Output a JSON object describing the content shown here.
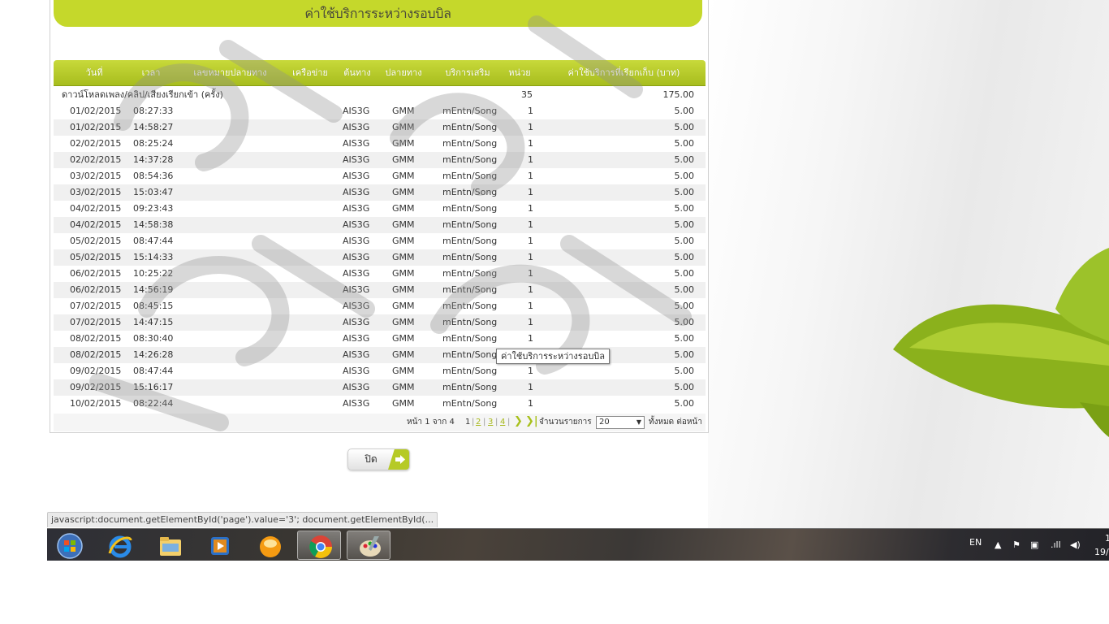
{
  "panel": {
    "title": "ค่าใช้บริการระหว่างรอบบิล",
    "columns": [
      "วันที่",
      "เวลา",
      "เลขหมายปลายทาง",
      "เครือข่าย",
      "ต้นทาง",
      "ปลายทาง",
      "บริการเสริม",
      "หน่วย",
      "ค่าใช้บริการที่เรียกเก็บ (บาท)"
    ],
    "group": {
      "label": "ดาวน์โหลดเพลง/คลิป/เสียงเรียกเข้า (ครั้ง)",
      "units": "35",
      "amount": "175.00"
    },
    "rows": [
      {
        "date": "01/02/2015",
        "time": "08:27:33",
        "source": "AIS3G",
        "dest": "GMM",
        "service": "mEntn/Song",
        "unit": "1",
        "amount": "5.00"
      },
      {
        "date": "01/02/2015",
        "time": "14:58:27",
        "source": "AIS3G",
        "dest": "GMM",
        "service": "mEntn/Song",
        "unit": "1",
        "amount": "5.00"
      },
      {
        "date": "02/02/2015",
        "time": "08:25:24",
        "source": "AIS3G",
        "dest": "GMM",
        "service": "mEntn/Song",
        "unit": "1",
        "amount": "5.00"
      },
      {
        "date": "02/02/2015",
        "time": "14:37:28",
        "source": "AIS3G",
        "dest": "GMM",
        "service": "mEntn/Song",
        "unit": "1",
        "amount": "5.00"
      },
      {
        "date": "03/02/2015",
        "time": "08:54:36",
        "source": "AIS3G",
        "dest": "GMM",
        "service": "mEntn/Song",
        "unit": "1",
        "amount": "5.00"
      },
      {
        "date": "03/02/2015",
        "time": "15:03:47",
        "source": "AIS3G",
        "dest": "GMM",
        "service": "mEntn/Song",
        "unit": "1",
        "amount": "5.00"
      },
      {
        "date": "04/02/2015",
        "time": "09:23:43",
        "source": "AIS3G",
        "dest": "GMM",
        "service": "mEntn/Song",
        "unit": "1",
        "amount": "5.00"
      },
      {
        "date": "04/02/2015",
        "time": "14:58:38",
        "source": "AIS3G",
        "dest": "GMM",
        "service": "mEntn/Song",
        "unit": "1",
        "amount": "5.00"
      },
      {
        "date": "05/02/2015",
        "time": "08:47:44",
        "source": "AIS3G",
        "dest": "GMM",
        "service": "mEntn/Song",
        "unit": "1",
        "amount": "5.00"
      },
      {
        "date": "05/02/2015",
        "time": "15:14:33",
        "source": "AIS3G",
        "dest": "GMM",
        "service": "mEntn/Song",
        "unit": "1",
        "amount": "5.00"
      },
      {
        "date": "06/02/2015",
        "time": "10:25:22",
        "source": "AIS3G",
        "dest": "GMM",
        "service": "mEntn/Song",
        "unit": "1",
        "amount": "5.00"
      },
      {
        "date": "06/02/2015",
        "time": "14:56:19",
        "source": "AIS3G",
        "dest": "GMM",
        "service": "mEntn/Song",
        "unit": "1",
        "amount": "5.00"
      },
      {
        "date": "07/02/2015",
        "time": "08:45:15",
        "source": "AIS3G",
        "dest": "GMM",
        "service": "mEntn/Song",
        "unit": "1",
        "amount": "5.00"
      },
      {
        "date": "07/02/2015",
        "time": "14:47:15",
        "source": "AIS3G",
        "dest": "GMM",
        "service": "mEntn/Song",
        "unit": "1",
        "amount": "5.00"
      },
      {
        "date": "08/02/2015",
        "time": "08:30:40",
        "source": "AIS3G",
        "dest": "GMM",
        "service": "mEntn/Song",
        "unit": "1",
        "amount": "5.00"
      },
      {
        "date": "08/02/2015",
        "time": "14:26:28",
        "source": "AIS3G",
        "dest": "GMM",
        "service": "mEntn/Song",
        "unit": "1",
        "amount": "5.00"
      },
      {
        "date": "09/02/2015",
        "time": "08:47:44",
        "source": "AIS3G",
        "dest": "GMM",
        "service": "mEntn/Song",
        "unit": "1",
        "amount": "5.00"
      },
      {
        "date": "09/02/2015",
        "time": "15:16:17",
        "source": "AIS3G",
        "dest": "GMM",
        "service": "mEntn/Song",
        "unit": "1",
        "amount": "5.00"
      },
      {
        "date": "10/02/2015",
        "time": "08:22:44",
        "source": "AIS3G",
        "dest": "GMM",
        "service": "mEntn/Song",
        "unit": "1",
        "amount": "5.00"
      }
    ],
    "pager": {
      "page_label": "หน้า 1 จาก 4",
      "pages": [
        "1",
        "2",
        "3",
        "4"
      ],
      "per_page_label": "จำนวนรายการ",
      "per_page_value": "20",
      "suffix": "ทั้งหมด ต่อหน้า"
    },
    "tooltip": "ค่าใช้บริการระหว่างรอบบิล",
    "watermark_text": "สำเนา"
  },
  "close_button": {
    "label": "ปิด"
  },
  "status_url": "javascript:document.getElementById('page').value='3';  document.getElementById(...",
  "taskbar": {
    "items": [
      "start-orb-icon",
      "internet-explorer-icon",
      "file-explorer-icon",
      "media-player-icon",
      "chat-app-icon",
      "chrome-icon",
      "paint-icon"
    ],
    "language": "EN",
    "clock_time": "1",
    "clock_date": "19/"
  },
  "colors": {
    "accent": "#c5d82b",
    "header": "#a7bd1e"
  }
}
